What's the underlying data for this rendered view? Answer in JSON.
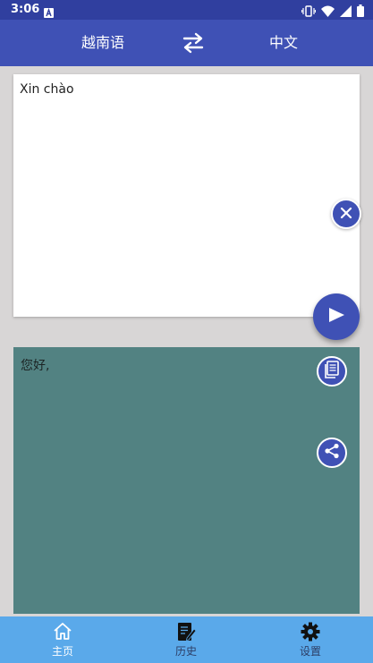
{
  "status_bar": {
    "time": "3:06",
    "notification_icon": "a-badge-icon",
    "icons": [
      "vibrate-icon",
      "wifi-icon",
      "signal-icon",
      "battery-icon"
    ]
  },
  "toolbar": {
    "source_language": "越南语",
    "target_language": "中文",
    "swap_icon": "swap-arrows-icon"
  },
  "input": {
    "text": "Xin chào"
  },
  "output": {
    "text": "您好,"
  },
  "bottom_nav": {
    "items": [
      {
        "label": "主页",
        "icon": "home-icon",
        "active": true
      },
      {
        "label": "历史",
        "icon": "history-icon",
        "active": false
      },
      {
        "label": "设置",
        "icon": "gear-icon",
        "active": false
      }
    ]
  },
  "colors": {
    "primary": "#3f51b5",
    "primary_dark": "#303f9f",
    "output_bg": "#528282",
    "bottom_nav_bg": "#5aa9ea"
  }
}
